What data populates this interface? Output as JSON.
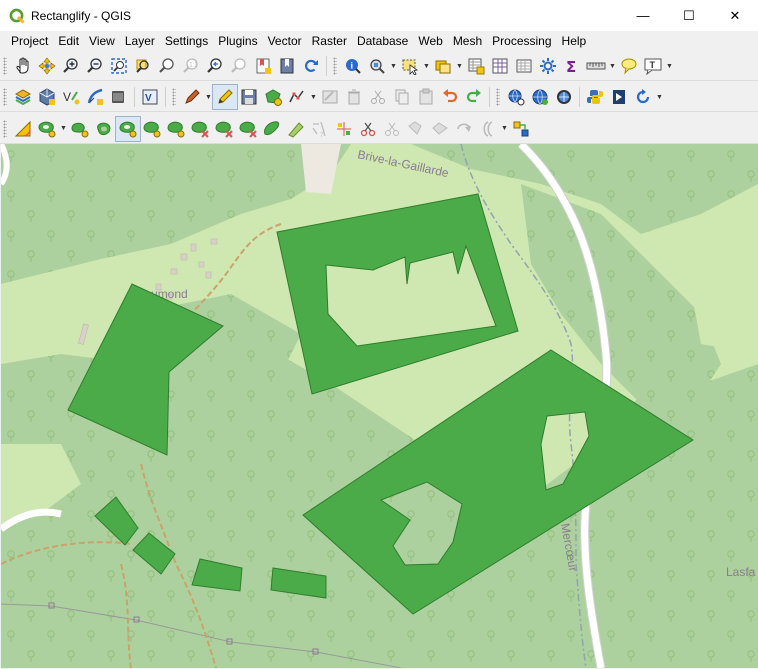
{
  "window": {
    "title": "Rectanglify - QGIS",
    "minimize": "—",
    "maximize": "☐",
    "close": "✕"
  },
  "menu": [
    "Project",
    "Edit",
    "View",
    "Layer",
    "Settings",
    "Plugins",
    "Vector",
    "Raster",
    "Database",
    "Web",
    "Mesh",
    "Processing",
    "Help"
  ],
  "toolbars": {
    "navigation": [
      "pan-icon",
      "pan-to-selection-icon",
      "zoom-in-icon",
      "zoom-out-icon",
      "zoom-full-icon",
      "zoom-to-selection-icon",
      "zoom-to-layer-icon",
      "zoom-native-icon",
      "zoom-last-icon",
      "zoom-next-icon",
      "new-bookmark-icon",
      "show-bookmarks-icon",
      "refresh-icon",
      "identify-icon",
      "measure-icon",
      "select-features-icon",
      "deselect-icon",
      "attribute-table-icon",
      "field-calculator-icon",
      "processing-toolbox-icon",
      "statistics-icon",
      "measure-line-icon",
      "map-tips-icon",
      "text-annotation-icon"
    ],
    "data_source": [
      "data-source-manager-icon",
      "new-geopackage-icon",
      "new-shapefile-icon",
      "new-spatialite-icon",
      "new-virtual-layer-icon",
      "python-console-icon"
    ],
    "digitizing": [
      "current-edits-icon",
      "toggle-editing-icon",
      "save-edits-icon",
      "add-polygon-icon",
      "vertex-tool-icon",
      "modify-attributes-icon",
      "delete-selected-icon",
      "cut-features-icon",
      "copy-features-icon",
      "paste-features-icon",
      "undo-icon",
      "redo-icon"
    ],
    "web": [
      "metasearch-icon",
      "qms-icon",
      "openstreetmap-icon",
      "python-icon",
      "plugin-icon",
      "plugin-reload-icon"
    ],
    "advanced_digitizing": [
      "advanced-digitizing-icon",
      "add-ring-icon",
      "add-part-icon",
      "fill-ring-icon",
      "delete-ring-icon",
      "delete-part-icon",
      "reshape-icon",
      "offset-curve-icon",
      "split-features-icon",
      "split-parts-icon",
      "merge-features-icon",
      "merge-attributes-icon",
      "rotate-point-symbols-icon",
      "simplify-icon"
    ]
  },
  "map": {
    "labels": {
      "town_north": "Brive-la-Gaillarde",
      "village": "Chaumond",
      "river": "Mercœur",
      "town_east": "Lasfa"
    },
    "colors": {
      "background": "#cfe8b1",
      "forest": "#add19e",
      "polygon_fill": "#4bab48",
      "polygon_stroke": "#2f7d2d",
      "road": "#ffffff",
      "path": "#c9a36a",
      "label": "#8b7b8f"
    }
  }
}
